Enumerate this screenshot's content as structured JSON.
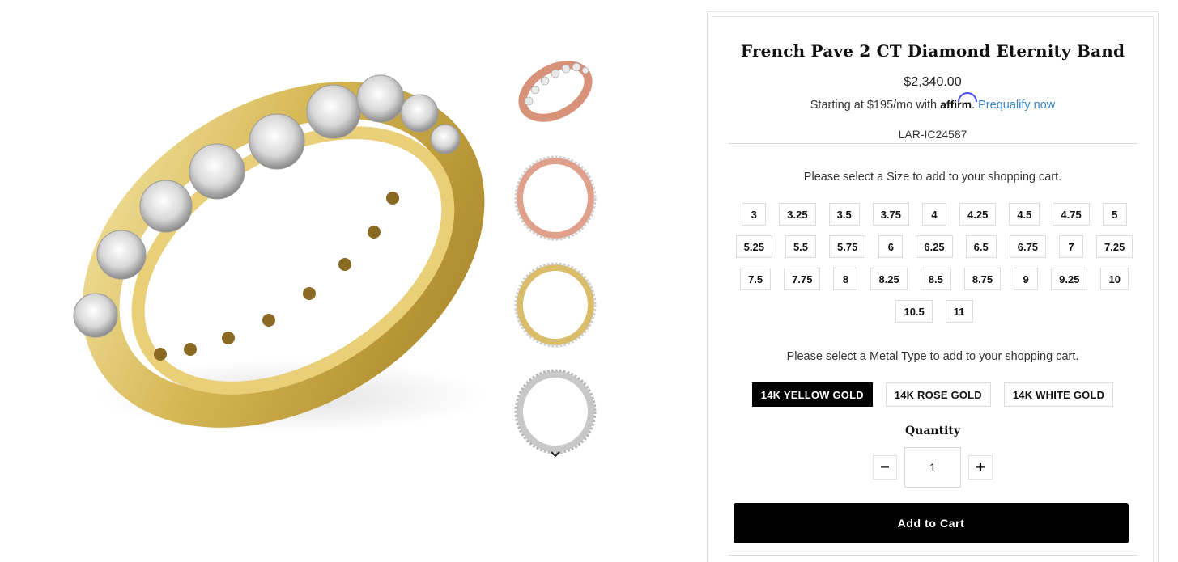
{
  "product": {
    "title": "French Pave 2 CT Diamond Eternity Band",
    "price": "$2,340.00",
    "financing_prefix": "Starting at $195/mo with",
    "affirm_logo": "affirm",
    "financing_link": "Prequalify now",
    "sku": "LAR-IC24587"
  },
  "thumbnails": [
    {
      "icon": "rose-gold-ring-angle-thumbnail",
      "metal_color": "#d9927a"
    },
    {
      "icon": "rose-gold-ring-front-thumbnail",
      "metal_color": "#e0a08c"
    },
    {
      "icon": "yellow-gold-ring-front-thumbnail",
      "metal_color": "#d9bd6a"
    },
    {
      "icon": "white-gold-ring-front-thumbnail",
      "metal_color": "#c8c8c8"
    }
  ],
  "main_image": {
    "icon": "yellow-gold-eternity-band-image",
    "metal_color": "#d8bc5c"
  },
  "size_selector": {
    "label": "Please select a Size to add to your shopping cart.",
    "options": [
      "3",
      "3.25",
      "3.5",
      "3.75",
      "4",
      "4.25",
      "4.5",
      "4.75",
      "5",
      "5.25",
      "5.5",
      "5.75",
      "6",
      "6.25",
      "6.5",
      "6.75",
      "7",
      "7.25",
      "7.5",
      "7.75",
      "8",
      "8.25",
      "8.5",
      "8.75",
      "9",
      "9.25",
      "10",
      "10.5",
      "11"
    ]
  },
  "metal_selector": {
    "label": "Please select a Metal Type to add to your shopping cart.",
    "options": [
      "14K YELLOW GOLD",
      "14K ROSE GOLD",
      "14K WHITE GOLD"
    ],
    "selected": "14K YELLOW GOLD"
  },
  "quantity": {
    "label": "Quantity",
    "value": "1",
    "decrement": "−",
    "increment": "+"
  },
  "add_to_cart": "Add to Cart",
  "colors": {
    "primary": "#000000",
    "link": "#3a87c8",
    "border": "#dcdcdc"
  }
}
